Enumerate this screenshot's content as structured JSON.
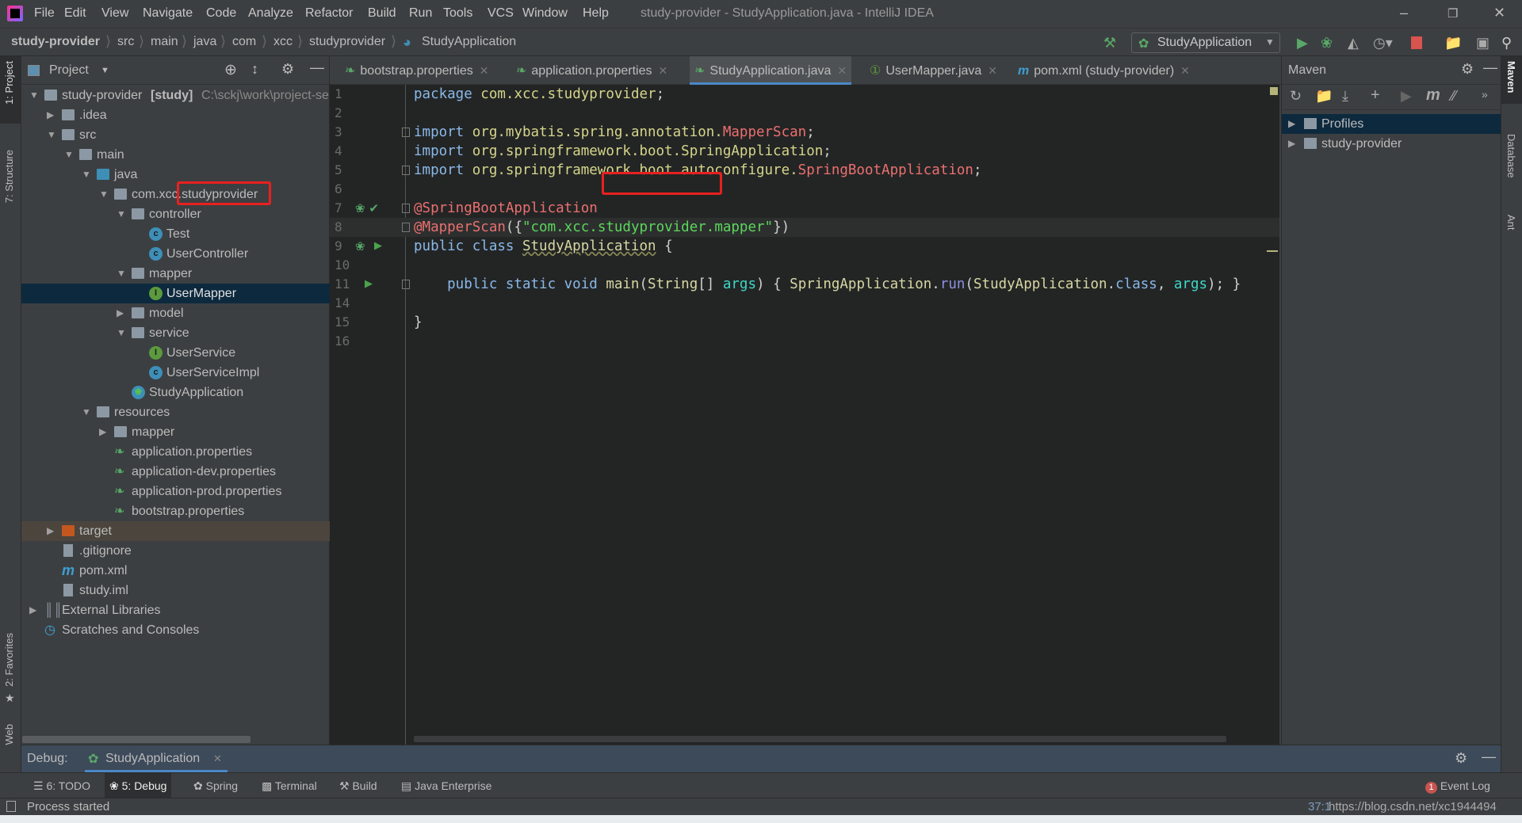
{
  "window": {
    "title": "study-provider - StudyApplication.java - IntelliJ IDEA"
  },
  "menu": [
    "File",
    "Edit",
    "View",
    "Navigate",
    "Code",
    "Analyze",
    "Refactor",
    "Build",
    "Run",
    "Tools",
    "VCS",
    "Window",
    "Help"
  ],
  "breadcrumb": [
    "study-provider",
    "src",
    "main",
    "java",
    "com",
    "xcc",
    "studyprovider",
    "StudyApplication"
  ],
  "toolbar": {
    "run_config": "StudyApplication"
  },
  "left_stripe": [
    "1: Project",
    "7: Structure",
    "2: Favorites",
    "Web"
  ],
  "right_stripe": [
    "Maven",
    "Database",
    "Ant"
  ],
  "project": {
    "title": "Project",
    "tree": [
      {
        "level": 0,
        "arrow": "open",
        "icon": "module",
        "label": "study-provider",
        "bold": " [study]",
        "path": " C:\\sckj\\work\\project-se"
      },
      {
        "level": 1,
        "arrow": "closed",
        "icon": "folder",
        "label": ".idea"
      },
      {
        "level": 1,
        "arrow": "open",
        "icon": "folder",
        "label": "src"
      },
      {
        "level": 2,
        "arrow": "open",
        "icon": "folder",
        "label": "main"
      },
      {
        "level": 3,
        "arrow": "open",
        "icon": "folder-blue",
        "label": "java"
      },
      {
        "level": 4,
        "arrow": "open",
        "icon": "package",
        "label": "com.xcc.studyprovider"
      },
      {
        "level": 5,
        "arrow": "open",
        "icon": "package",
        "label": "controller"
      },
      {
        "level": 6,
        "arrow": "none",
        "icon": "class",
        "label": "Test"
      },
      {
        "level": 6,
        "arrow": "none",
        "icon": "class",
        "label": "UserController"
      },
      {
        "level": 5,
        "arrow": "open",
        "icon": "package",
        "label": "mapper"
      },
      {
        "level": 6,
        "arrow": "none",
        "icon": "interface",
        "label": "UserMapper",
        "selected": true
      },
      {
        "level": 5,
        "arrow": "closed",
        "icon": "package",
        "label": "model"
      },
      {
        "level": 5,
        "arrow": "open",
        "icon": "package",
        "label": "service"
      },
      {
        "level": 6,
        "arrow": "none",
        "icon": "interface",
        "label": "UserService"
      },
      {
        "level": 6,
        "arrow": "none",
        "icon": "class",
        "label": "UserServiceImpl"
      },
      {
        "level": 5,
        "arrow": "none",
        "icon": "spring-class",
        "label": "StudyApplication"
      },
      {
        "level": 3,
        "arrow": "open",
        "icon": "folder",
        "label": "resources"
      },
      {
        "level": 4,
        "arrow": "closed",
        "icon": "folder",
        "label": "mapper"
      },
      {
        "level": 4,
        "arrow": "none",
        "icon": "spring-properties",
        "label": "application.properties"
      },
      {
        "level": 4,
        "arrow": "none",
        "icon": "spring-properties",
        "label": "application-dev.properties"
      },
      {
        "level": 4,
        "arrow": "none",
        "icon": "spring-properties",
        "label": "application-prod.properties"
      },
      {
        "level": 4,
        "arrow": "none",
        "icon": "spring-properties",
        "label": "bootstrap.properties"
      },
      {
        "level": 1,
        "arrow": "closed",
        "icon": "folder-orange",
        "label": "target",
        "highlight": true
      },
      {
        "level": 1,
        "arrow": "none",
        "icon": "file",
        "label": ".gitignore"
      },
      {
        "level": 1,
        "arrow": "none",
        "icon": "maven",
        "label": "pom.xml"
      },
      {
        "level": 1,
        "arrow": "none",
        "icon": "file",
        "label": "study.iml"
      },
      {
        "level": 0,
        "arrow": "closed",
        "icon": "libraries",
        "label": "External Libraries"
      },
      {
        "level": 0,
        "arrow": "none",
        "icon": "scratches",
        "label": "Scratches and Consoles"
      }
    ]
  },
  "tabs": [
    {
      "label": "bootstrap.properties",
      "icon": "spring-icon"
    },
    {
      "label": "application.properties",
      "icon": "spring-icon"
    },
    {
      "label": "StudyApplication.java",
      "icon": "spring-class-icon",
      "active": true
    },
    {
      "label": "UserMapper.java",
      "icon": "interface-icon"
    },
    {
      "label": "pom.xml (study-provider)",
      "icon": "maven-icon"
    }
  ],
  "editor": {
    "lines": [
      {
        "n": "1",
        "tokens": [
          [
            "package ",
            "k"
          ],
          [
            "com.xcc.studyprovider",
            "p"
          ],
          [
            ";",
            "o"
          ]
        ]
      },
      {
        "n": "2",
        "tokens": []
      },
      {
        "n": "3",
        "fold": true,
        "tokens": [
          [
            "import ",
            "k"
          ],
          [
            "org.mybatis.spring.annotation.",
            "p"
          ],
          [
            "MapperScan",
            "e"
          ],
          [
            ";",
            "o"
          ]
        ]
      },
      {
        "n": "4",
        "tokens": [
          [
            "import ",
            "k"
          ],
          [
            "org.springframework.boot.SpringApplication",
            "p"
          ],
          [
            ";",
            "o"
          ]
        ]
      },
      {
        "n": "5",
        "fold": true,
        "tokens": [
          [
            "import ",
            "k"
          ],
          [
            "org.springframework.boot.autoconfigure.",
            "p"
          ],
          [
            "SpringBootApplication",
            "e"
          ],
          [
            ";",
            "o"
          ]
        ]
      },
      {
        "n": "6",
        "tokens": []
      },
      {
        "n": "7",
        "fold": true,
        "gutter": "bean-icons",
        "tokens": [
          [
            "@SpringBootApplication",
            "e"
          ]
        ]
      },
      {
        "n": "8",
        "fold": true,
        "current": true,
        "tokens": [
          [
            "@MapperScan",
            "e"
          ],
          [
            "({",
            "o"
          ],
          [
            "\"com.xcc.",
            "s"
          ],
          [
            "studyprovider",
            "s"
          ],
          [
            ".mapper\"",
            "s"
          ],
          [
            "})",
            "o"
          ]
        ]
      },
      {
        "n": "9",
        "gutter": "run-spring",
        "tokens": [
          [
            "public class ",
            "k"
          ],
          [
            "StudyApplication",
            "c"
          ],
          [
            " {",
            "o"
          ]
        ]
      },
      {
        "n": "10",
        "tokens": []
      },
      {
        "n": "11",
        "fold": true,
        "gutter": "run",
        "tokens": [
          [
            "    public static void ",
            "k"
          ],
          [
            "main",
            "n"
          ],
          [
            "(",
            "o"
          ],
          [
            "String",
            "n"
          ],
          [
            "[] ",
            "o"
          ],
          [
            "args",
            "a"
          ],
          [
            ") { ",
            "o"
          ],
          [
            "SpringApplication",
            "n"
          ],
          [
            ".",
            "o"
          ],
          [
            "run",
            "m"
          ],
          [
            "(",
            "o"
          ],
          [
            "StudyApplication",
            "n"
          ],
          [
            ".",
            "o"
          ],
          [
            "class",
            "k"
          ],
          [
            ", ",
            "o"
          ],
          [
            "args",
            "a"
          ],
          [
            "); }",
            "o"
          ]
        ]
      },
      {
        "n": "14",
        "tokens": []
      },
      {
        "n": "15",
        "tokens": [
          [
            "}",
            "o"
          ]
        ]
      },
      {
        "n": "16",
        "tokens": []
      }
    ]
  },
  "maven": {
    "title": "Maven",
    "items": [
      {
        "label": "Profiles",
        "selected": true
      },
      {
        "label": "study-provider"
      }
    ]
  },
  "debug": {
    "label": "Debug:",
    "tab": "StudyApplication"
  },
  "tool_windows": [
    "6: TODO",
    "5: Debug",
    "Spring",
    "Terminal",
    "Build",
    "Java Enterprise"
  ],
  "event_log": {
    "label": "Event Log",
    "count": "1"
  },
  "status": {
    "message": "Process started",
    "position": "37:1",
    "watermark": "https://blog.csdn.net/xc1944494"
  }
}
